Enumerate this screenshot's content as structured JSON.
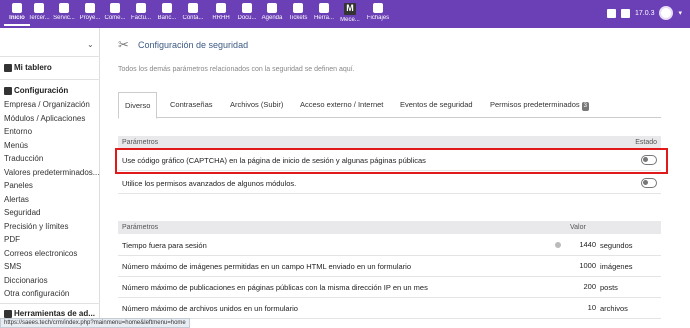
{
  "topnav": {
    "items": [
      {
        "label": "Inicio",
        "icon": "home-icon"
      },
      {
        "label": "Tercer...",
        "icon": "building-icon"
      },
      {
        "label": "Servic...",
        "icon": "cube-icon"
      },
      {
        "label": "Proye...",
        "icon": "sitemap-icon"
      },
      {
        "label": "Come...",
        "icon": "suitcase-icon"
      },
      {
        "label": "Factu...",
        "icon": "bill-icon"
      },
      {
        "label": "Banc...",
        "icon": "bank-icon"
      },
      {
        "label": "Conta...",
        "icon": "calculator-icon"
      },
      {
        "label": "RRHH",
        "icon": "users-icon"
      },
      {
        "label": "Docu...",
        "icon": "folder-icon"
      },
      {
        "label": "Agenda",
        "icon": "calendar-icon"
      },
      {
        "label": "Tickets",
        "icon": "ticket-icon"
      },
      {
        "label": "Herra...",
        "icon": "wrench-icon"
      },
      {
        "label": "Mece...",
        "icon": "m-logo-icon"
      },
      {
        "label": "Fichajes",
        "icon": "clock-icon"
      }
    ],
    "version": "17.0.3"
  },
  "sidebar": {
    "mi_tablero": "Mi tablero",
    "configuracion": "Configuración",
    "items": [
      "Empresa / Organización",
      "Módulos / Aplicaciones",
      "Entorno",
      "Menús",
      "Traducción",
      "Valores predeterminados...",
      "Paneles",
      "Alertas",
      "Seguridad",
      "Precisión y límites",
      "PDF",
      "Correos electronicos",
      "SMS",
      "Diccionarios",
      "Otra configuración"
    ],
    "herramientas": "Herramientas de ad..."
  },
  "page": {
    "title": "Configuración de seguridad",
    "subtitle": "Todos los demás parámetros relacionados con la seguridad se definen aquí.",
    "tabs": [
      {
        "label": "Diverso",
        "badge": ""
      },
      {
        "label": "Contraseñas",
        "badge": ""
      },
      {
        "label": "Archivos (Subir)",
        "badge": ""
      },
      {
        "label": "Acceso externo / Internet",
        "badge": ""
      },
      {
        "label": "Eventos de seguridad",
        "badge": ""
      },
      {
        "label": "Permisos predeterminados",
        "badge": "3"
      }
    ]
  },
  "table1": {
    "col_param": "Parámetros",
    "col_state": "Estado",
    "rows": [
      {
        "label": "Use código gráfico (CAPTCHA) en la página de inicio de sesión y algunas páginas públicas",
        "enabled": false
      },
      {
        "label": "Utilice los permisos avanzados de algunos módulos.",
        "enabled": false
      }
    ]
  },
  "table2": {
    "col_param": "Parámetros",
    "col_value": "Valor",
    "rows": [
      {
        "label": "Tiempo fuera para sesión",
        "value": "1440",
        "unit": "segundos",
        "info": true
      },
      {
        "label": "Número máximo de imágenes permitidas en un campo HTML enviado en un formulario",
        "value": "1000",
        "unit": "imágenes",
        "info": false
      },
      {
        "label": "Número máximo de publicaciones en páginas públicas con la misma dirección IP en un mes",
        "value": "200",
        "unit": "posts",
        "info": false
      },
      {
        "label": "Número máximo de archivos unidos en un formulario",
        "value": "10",
        "unit": "archivos",
        "info": false
      }
    ]
  },
  "statusbar": "https://saees.tech/crm/index.php?mainmenu=home&leftmenu=home",
  "colors": {
    "topbar": "#6b3fb5",
    "highlight": "#e0191a",
    "title": "#3d5a84"
  }
}
